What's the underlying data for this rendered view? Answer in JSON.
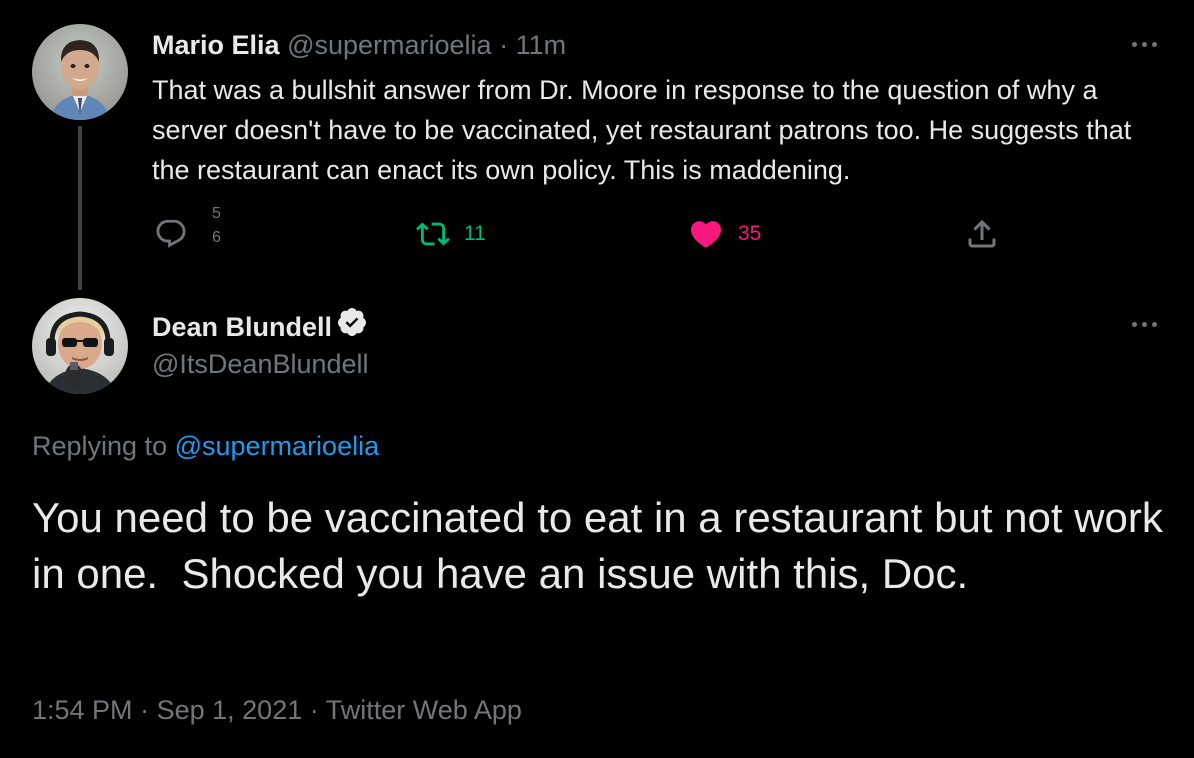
{
  "parent_tweet": {
    "author_name": "Mario Elia",
    "author_handle": "@supermarioelia",
    "separator": "·",
    "time": "11m",
    "text": "That was a bullshit answer from Dr. Moore in response to the question of why a server doesn't have to be vaccinated, yet restaurant patrons too. He suggests that the restaurant can enact its own policy. This is maddening.",
    "reply_count_partial": "5\n6",
    "retweet_count": "11",
    "like_count": "35",
    "icons": {
      "reply": "reply-icon",
      "retweet": "retweet-icon",
      "like": "heart-icon",
      "share": "share-icon",
      "more": "more-icon"
    },
    "colors": {
      "retweet": "#00ba7c",
      "like": "#f91880",
      "muted": "#71767b"
    }
  },
  "main_tweet": {
    "author_name": "Dean Blundell",
    "author_handle": "@ItsDeanBlundell",
    "verified_icon": "verified-badge-icon",
    "replying_prefix": "Replying to",
    "replying_handle": "@supermarioelia",
    "text": "You need to be vaccinated to eat in a restaurant but not work in one.  Shocked you have an issue with this, Doc.",
    "time": "1:54 PM",
    "date": "Sep 1, 2021",
    "source": "Twitter Web App",
    "separator": "·",
    "colors": {
      "link": "#1d9bf0",
      "background": "#000000",
      "text": "#e7e9ea"
    }
  }
}
